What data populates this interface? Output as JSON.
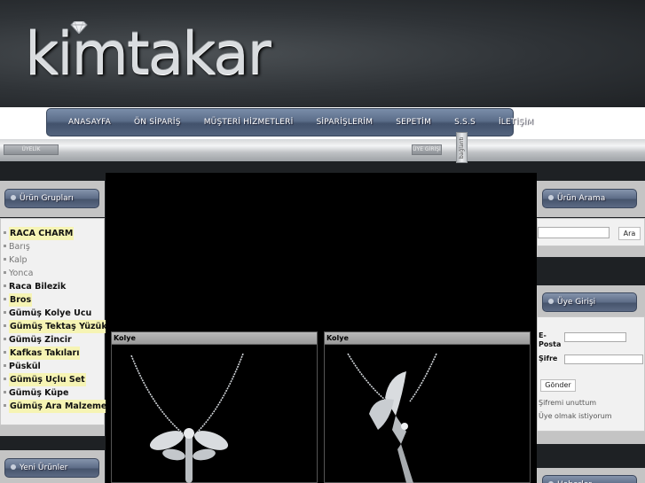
{
  "brand": {
    "logo_text": "kimtakar"
  },
  "nav": {
    "items": [
      {
        "label": "ANASAYFA"
      },
      {
        "label": "ÖN SİPARİŞ"
      },
      {
        "label": "MÜŞTERİ HİZMETLERİ"
      },
      {
        "label": "SİPARİŞLERİM"
      },
      {
        "label": "SEPETİM"
      },
      {
        "label": "S.S.S"
      },
      {
        "label": "İLETİŞİM"
      }
    ]
  },
  "toolbar": {
    "left_button": "ÜYELİK",
    "right_button": "ÜYE GİRİŞİ",
    "side_tab": "bağlantı"
  },
  "left": {
    "product_groups_title": "Ürün Grupları",
    "categories": [
      {
        "label": "RACA CHARM",
        "style": "hl"
      },
      {
        "label": "Barış",
        "style": "dim"
      },
      {
        "label": "Kalp",
        "style": "dim"
      },
      {
        "label": "Yonca",
        "style": "dim"
      },
      {
        "label": "Raca Bilezik",
        "style": ""
      },
      {
        "label": "Bros",
        "style": "hl"
      },
      {
        "label": "Gümüş Kolye Ucu",
        "style": ""
      },
      {
        "label": "Gümüş Tektaş Yüzük",
        "style": "hl"
      },
      {
        "label": "Gümüş Zincir",
        "style": ""
      },
      {
        "label": "Kafkas Takıları",
        "style": "hl"
      },
      {
        "label": "Püskül",
        "style": ""
      },
      {
        "label": "Gümüş Uçlu Set",
        "style": "hl"
      },
      {
        "label": "Gümüş Küpe",
        "style": ""
      },
      {
        "label": "Gümüş Ara Malzeme",
        "style": "hl"
      }
    ],
    "new_products_title": "Yeni Ürünler"
  },
  "products": [
    {
      "title": "Kolye"
    },
    {
      "title": "Kolye"
    }
  ],
  "right": {
    "search_title": "Ürün Arama",
    "search_button": "Ara",
    "search_value": "",
    "login_title": "Üye Girişi",
    "email_label": "E-Posta",
    "password_label": "Şifre",
    "submit_button": "Gönder",
    "forgot_link": "Şifremi unuttum",
    "register_link": "Üye olmak istiyorum",
    "news_title": "Haberler"
  },
  "colors": {
    "nav_gradient_mid": "#5b6d89",
    "highlight": "#f6f4b4",
    "background": "#1e2124"
  }
}
